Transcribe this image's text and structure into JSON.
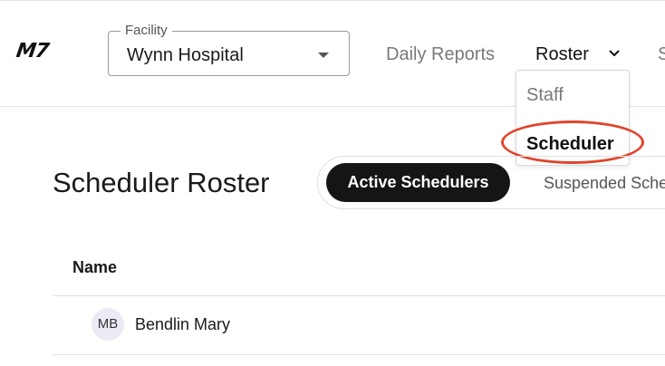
{
  "header": {
    "logo": "M7",
    "facility": {
      "label": "Facility",
      "value": "Wynn Hospital"
    },
    "nav": {
      "daily_reports": "Daily Reports",
      "roster": "Roster",
      "truncated_item": "S"
    }
  },
  "roster_menu": {
    "items": [
      "Staff",
      "Scheduler"
    ],
    "selected": "Scheduler"
  },
  "page": {
    "title": "Scheduler Roster",
    "tabs": {
      "active": "Active Schedulers",
      "inactive": "Suspended Schedulers"
    }
  },
  "table": {
    "columns": [
      "Name"
    ],
    "rows": [
      {
        "initials": "MB",
        "name": "Bendlin Mary"
      }
    ]
  },
  "colors": {
    "accent_ring": "#e0452b",
    "active_tab_bg": "#151515"
  }
}
